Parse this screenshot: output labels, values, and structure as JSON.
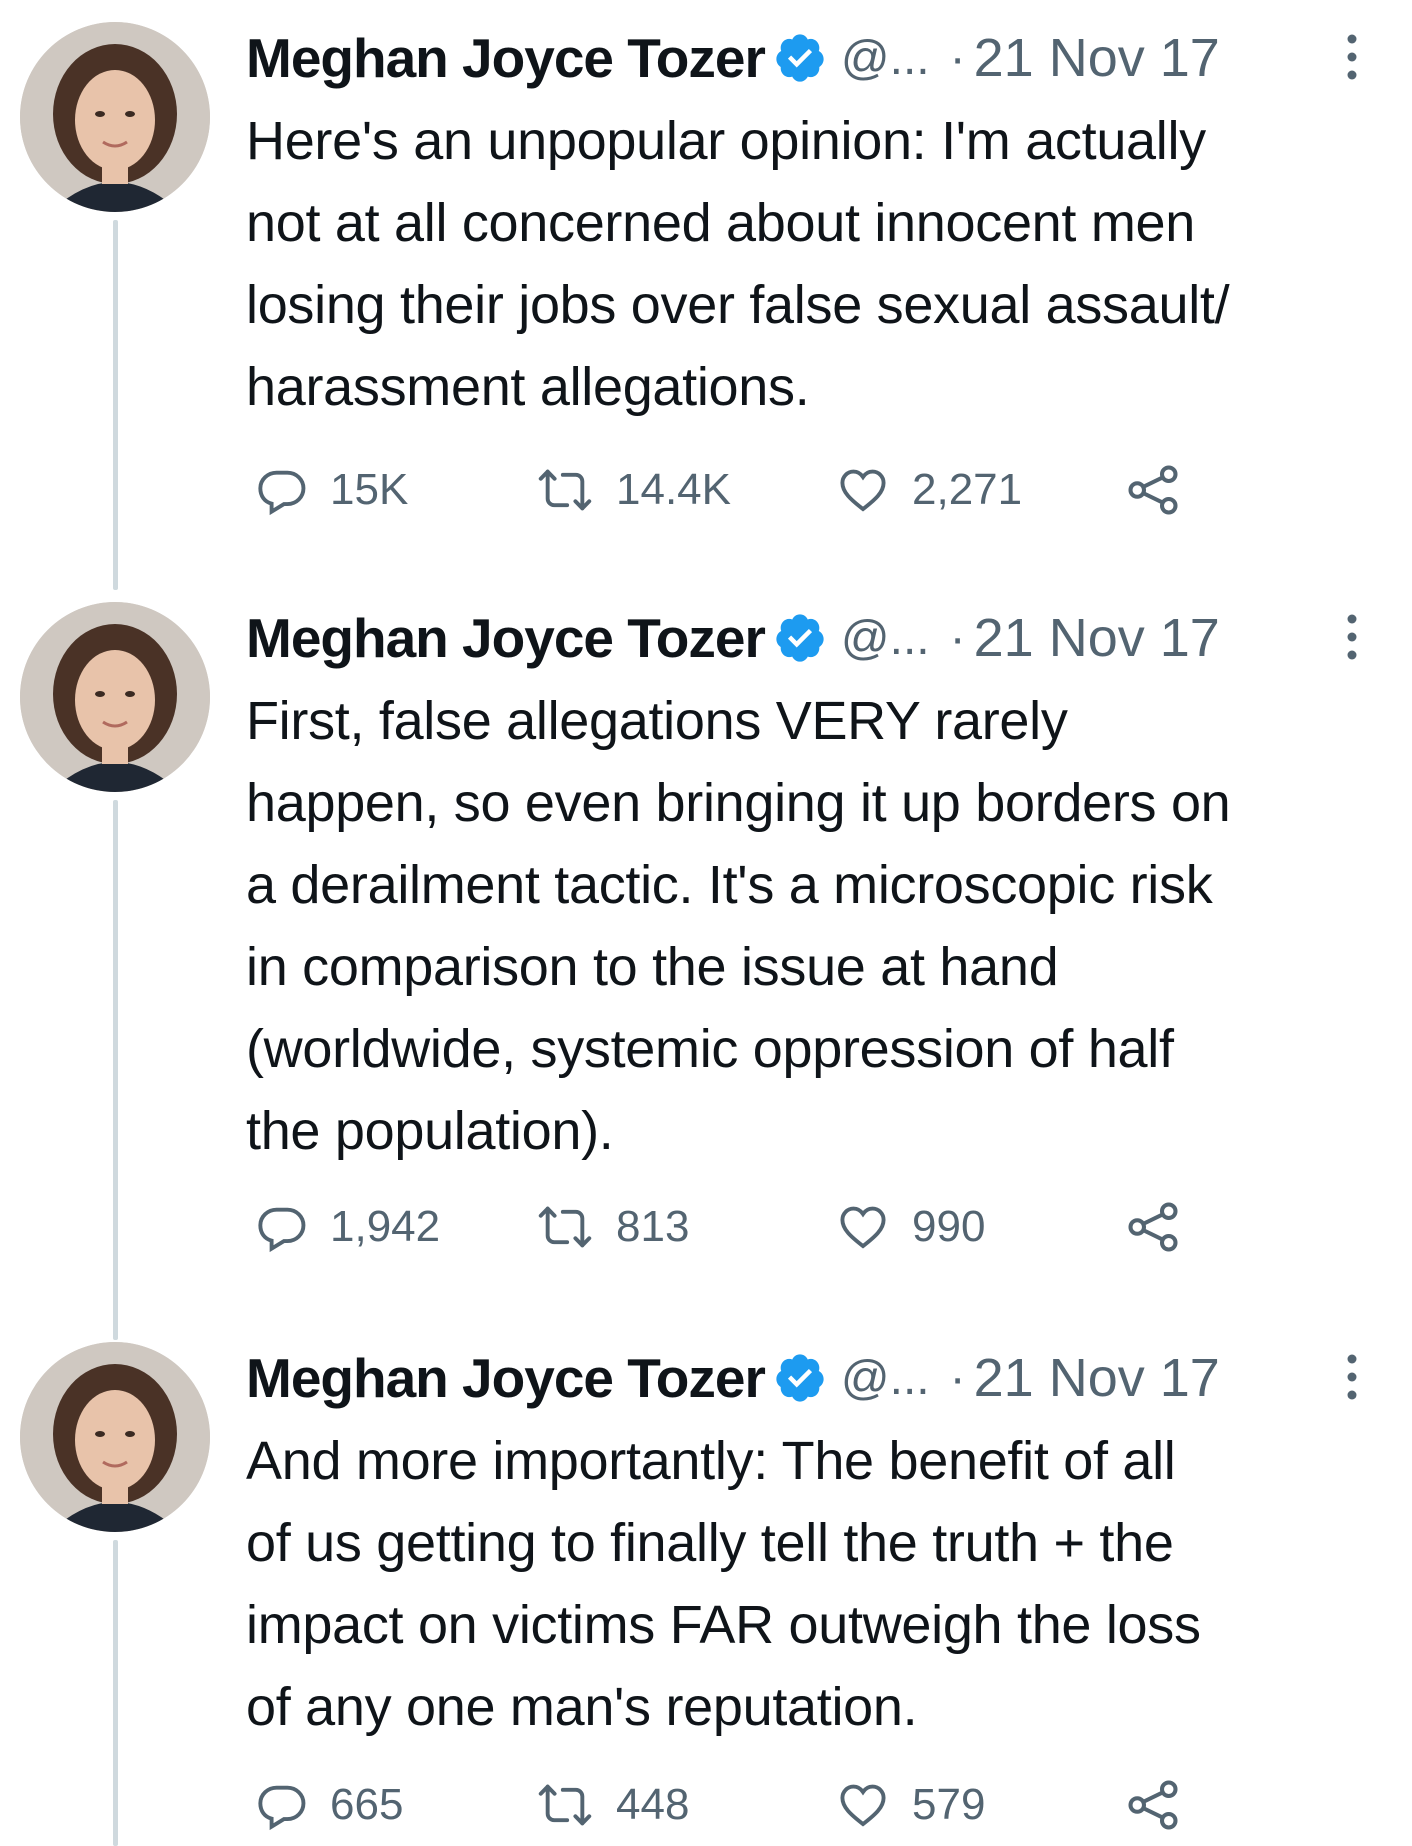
{
  "tweets": [
    {
      "author": "Meghan Joyce Tozer",
      "handle": "@...",
      "separator": "·",
      "date": "21 Nov 17",
      "text": "Here's an unpopular opinion: I'm actually\nnot at all concerned about innocent men\nlosing their jobs over false sexual assault/\nharassment allegations.",
      "replies": "15K",
      "retweets": "14.4K",
      "likes": "2,271"
    },
    {
      "author": "Meghan Joyce Tozer",
      "handle": "@...",
      "separator": "·",
      "date": "21 Nov 17",
      "text": "First, false allegations VERY rarely\nhappen, so even bringing it up borders on\na derailment tactic. It's a microscopic risk\nin comparison to the issue at hand\n(worldwide, systemic oppression of half\nthe population).",
      "replies": "1,942",
      "retweets": "813",
      "likes": "990"
    },
    {
      "author": "Meghan Joyce Tozer",
      "handle": "@...",
      "separator": "·",
      "date": "21 Nov 17",
      "text": "And more importantly: The benefit of all\nof us getting to finally tell the truth + the\nimpact on victims FAR outweigh the loss\nof any one man's reputation.",
      "replies": "665",
      "retweets": "448",
      "likes": "579"
    }
  ],
  "icons": {
    "reply": "reply-icon",
    "retweet": "retweet-icon",
    "like": "heart-icon",
    "share": "share-icon",
    "verified": "verified-badge-icon",
    "more": "more-options-icon"
  },
  "colors": {
    "text": "#0f1419",
    "secondary": "#536471",
    "verified": "#1d9bf0",
    "thread_line": "#cfd9de"
  }
}
